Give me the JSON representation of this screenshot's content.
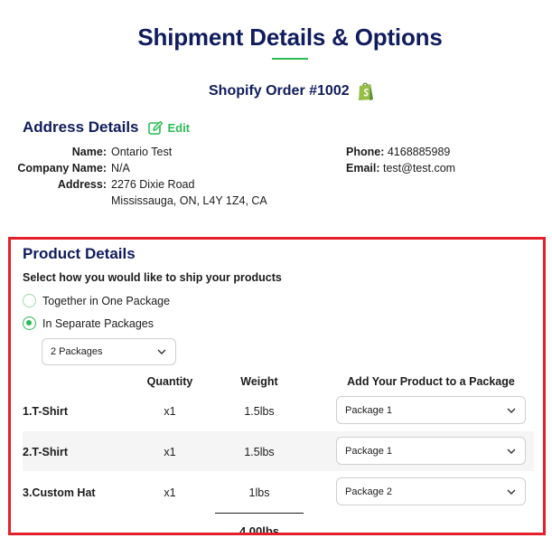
{
  "header": {
    "title": "Shipment Details & Options",
    "order_title": "Shopify Order #1002",
    "accent_color": "#2dbb55",
    "title_color": "#101c5e"
  },
  "address": {
    "section_title": "Address Details",
    "edit_label": "Edit",
    "name_label": "Name:",
    "name_value": "Ontario Test",
    "company_label": "Company Name:",
    "company_value": "N/A",
    "address_label": "Address:",
    "address_line1": "2276 Dixie Road",
    "address_line2": "Mississauga, ON, L4Y 1Z4, CA",
    "phone_label": "Phone:",
    "phone_value": "4168885989",
    "email_label": "Email:",
    "email_value": "test@test.com"
  },
  "products": {
    "section_title": "Product Details",
    "ship_prompt": "Select how you would like to ship your products",
    "option_together": "Together in One Package",
    "option_separate": "In Separate Packages",
    "selected_option": "In Separate Packages",
    "package_count": "2 Packages",
    "columns": {
      "quantity": "Quantity",
      "weight": "Weight",
      "package": "Add Your Product to a Package"
    },
    "rows": [
      {
        "name": "1.T-Shirt",
        "quantity": "x1",
        "weight": "1.5lbs",
        "package": "Package 1"
      },
      {
        "name": "2.T-Shirt",
        "quantity": "x1",
        "weight": "1.5lbs",
        "package": "Package 1"
      },
      {
        "name": "3.Custom Hat",
        "quantity": "x1",
        "weight": "1lbs",
        "package": "Package 2"
      }
    ],
    "total_weight": "4.00lbs",
    "highlight_color": "#e3202a"
  }
}
